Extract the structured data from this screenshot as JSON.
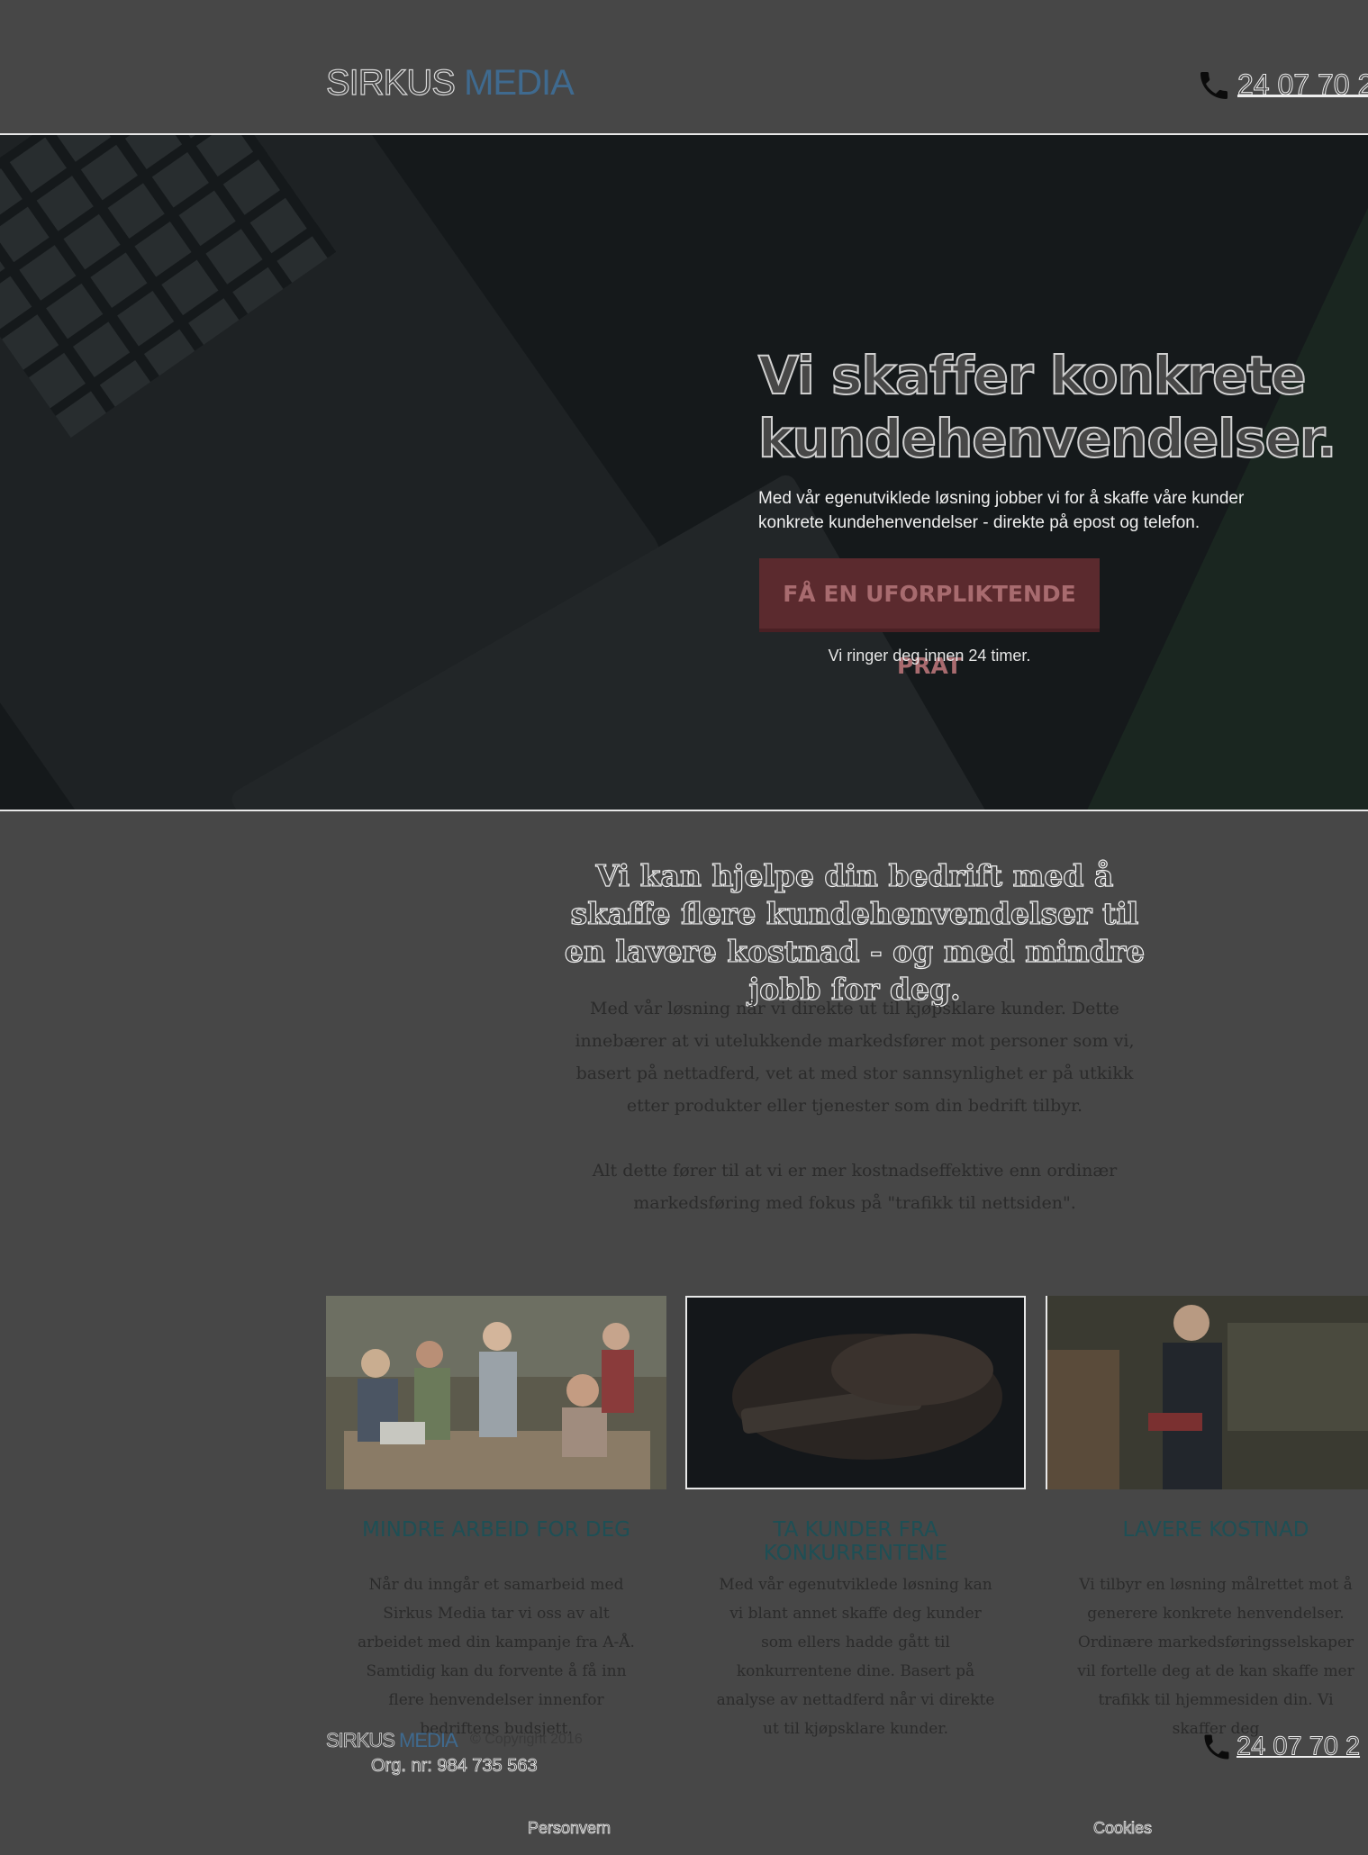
{
  "header": {
    "logo_part1": "SIRKUS",
    "logo_part2": "MEDIA",
    "phone": "24 07 70 2"
  },
  "hero": {
    "title": "Vi skaffer konkrete kundehenvendelser.",
    "text": "Med vår egenutviklede løsning jobber vi for å skaffe våre kunder konkrete kundehenvendelser - direkte på epost og telefon.",
    "cta_label": "FÅ EN UFORPLIKTENDE PRAT",
    "cta_sub": "Vi ringer deg innen 24 timer."
  },
  "intro": {
    "title": "Vi kan hjelpe din bedrift med å skaffe flere kundehenvendelser til en lavere kostnad - og med mindre jobb for deg.",
    "p1": "Med vår løsning når vi direkte ut til kjøpsklare kunder. Dette innebærer at vi utelukkende markedsfører mot personer som vi, basert på nettadferd, vet at med stor sannsynlighet er på utkikk etter produkter eller tjenester som din bedrift tilbyr.",
    "p2": "Alt dette fører til at vi er mer kostnadseffektive enn ordinær markedsføring med fokus på \"trafikk til nettsiden\"."
  },
  "cards": [
    {
      "title": "MINDRE ARBEID FOR DEG",
      "text": "Når du inngår et samarbeid med Sirkus Media tar vi oss av alt arbeidet med din kampanje fra A-Å. Samtidig kan du forvente å få inn flere henvendelser innenfor bedriftens budsjett."
    },
    {
      "title": "TA KUNDER FRA KONKURRENTENE",
      "text": "Med vår egenutviklede løsning kan vi blant annet skaffe deg kunder som ellers hadde gått til konkurrentene dine. Basert på analyse av nettadferd når vi direkte ut til kjøpsklare kunder."
    },
    {
      "title": "LAVERE KOSTNAD",
      "text": "Vi tilbyr en løsning målrettet mot å generere konkrete henvendelser. Ordinære markedsføringsselskaper vil fortelle deg at de kan skaffe mer trafikk til hjemmesiden din. Vi skaffer deg"
    }
  ],
  "footer": {
    "logo_part1": "SIRKUS",
    "logo_part2": "MEDIA",
    "copyright": "© Copyright 2016",
    "org": "Org. nr: 984 735 563",
    "phone": "24 07 70 2",
    "link_privacy": "Personvern",
    "link_cookies": "Cookies"
  },
  "icons": {
    "phone": "phone-icon"
  }
}
